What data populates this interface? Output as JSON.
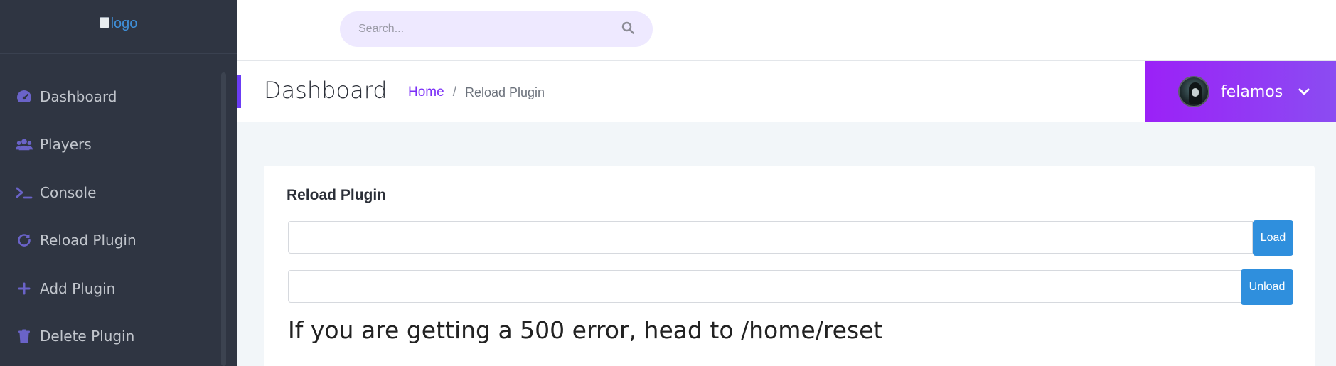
{
  "sidebar": {
    "logo_alt": "logo",
    "items": [
      {
        "label": "Dashboard",
        "icon": "dashboard-gauge-icon"
      },
      {
        "label": "Players",
        "icon": "users-icon"
      },
      {
        "label": "Console",
        "icon": "terminal-icon"
      },
      {
        "label": "Reload Plugin",
        "icon": "reload-icon"
      },
      {
        "label": "Add Plugin",
        "icon": "plus-icon"
      },
      {
        "label": "Delete Plugin",
        "icon": "trash-icon"
      }
    ]
  },
  "search": {
    "placeholder": "Search...",
    "icon": "search-icon"
  },
  "header": {
    "title": "Dashboard",
    "breadcrumb": {
      "home": "Home",
      "separator": "/",
      "current": "Reload Plugin"
    }
  },
  "user": {
    "name": "felamos",
    "icon": "chevron-down-icon"
  },
  "card": {
    "title": "Reload Plugin",
    "load_value": "",
    "unload_value": "",
    "load_button": "Load",
    "unload_button": "Unload",
    "notice": "If you are getting a 500 error, head to /home/reset"
  },
  "colors": {
    "sidebar_bg": "#2f3542",
    "accent": "#6b3cf5",
    "link": "#7b2ff7",
    "button": "#2f8fdd",
    "user_panel": "#9b21f7"
  }
}
